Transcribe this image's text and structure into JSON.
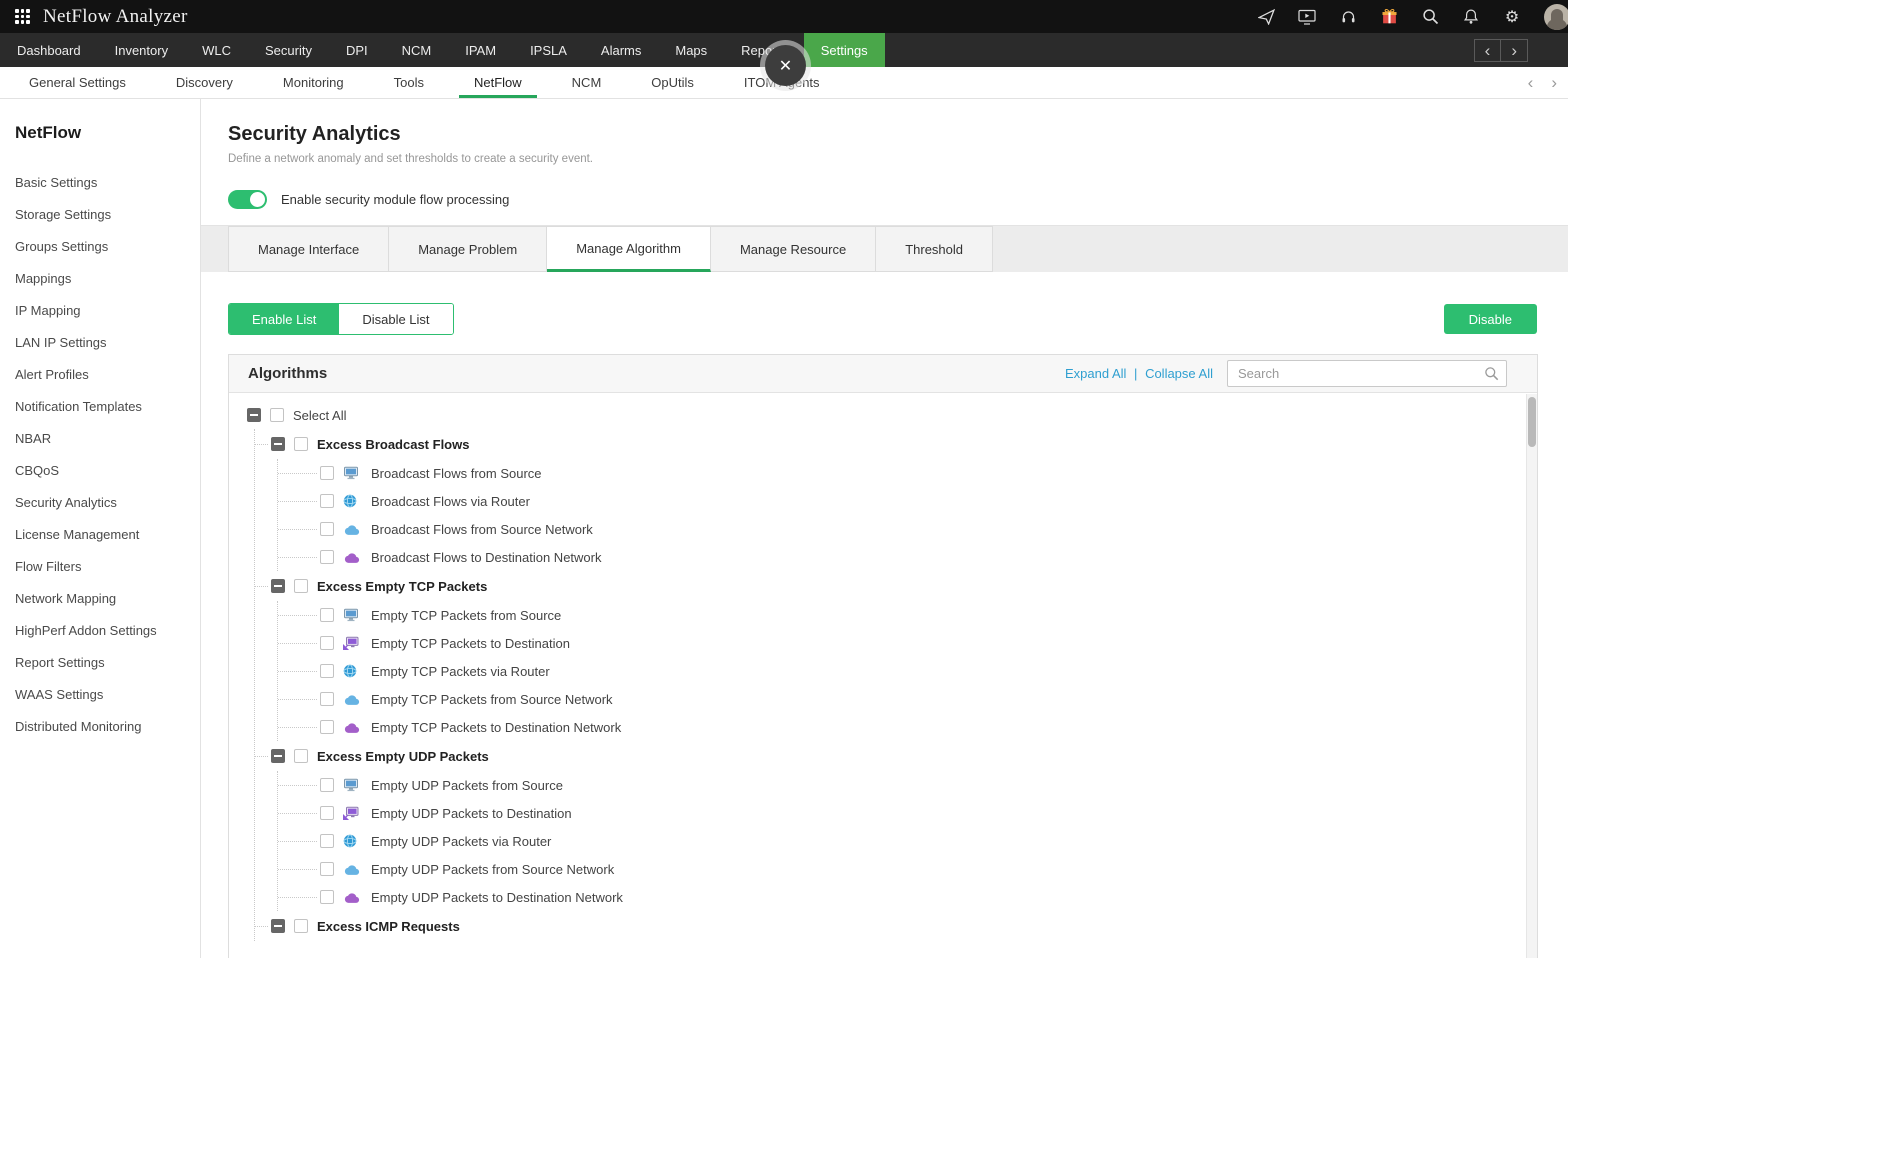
{
  "colors": {
    "accent_green": "#2dbe70",
    "nav_active_green": "#4aa74a",
    "tab_underline_green": "#26a65b",
    "link_blue": "#2f9fd0"
  },
  "icons": {
    "close": "✕",
    "back_chevron": "‹",
    "forward_chevron": "›",
    "gear": "⚙"
  },
  "topbar": {
    "title": "NetFlow Analyzer",
    "icon_names": [
      "send-icon",
      "screen-share-icon",
      "headset-icon",
      "gift-icon",
      "search-icon",
      "bell-icon",
      "gear-icon",
      "user-avatar"
    ]
  },
  "topnav": {
    "items": [
      "Dashboard",
      "Inventory",
      "WLC",
      "Security",
      "DPI",
      "NCM",
      "IPAM",
      "IPSLA",
      "Alarms",
      "Maps",
      "Reports",
      "Settings"
    ],
    "active": "Settings"
  },
  "subnav": {
    "items": [
      "General Settings",
      "Discovery",
      "Monitoring",
      "Tools",
      "NetFlow",
      "NCM",
      "OpUtils",
      "ITOM Agents"
    ],
    "active": "NetFlow"
  },
  "sidebar": {
    "title": "NetFlow",
    "items": [
      "Basic Settings",
      "Storage Settings",
      "Groups Settings",
      "Mappings",
      "IP Mapping",
      "LAN IP Settings",
      "Alert Profiles",
      "Notification Templates",
      "NBAR",
      "CBQoS",
      "Security Analytics",
      "License Management",
      "Flow Filters",
      "Network Mapping",
      "HighPerf Addon Settings",
      "Report Settings",
      "WAAS Settings",
      "Distributed Monitoring"
    ]
  },
  "page": {
    "title": "Security Analytics",
    "subtitle": "Define a network anomaly and set thresholds to create a security event.",
    "toggle_label": "Enable security module flow processing",
    "toggle_state": "on"
  },
  "tabs": {
    "items": [
      "Manage Interface",
      "Manage Problem",
      "Manage Algorithm",
      "Manage Resource",
      "Threshold"
    ],
    "active": "Manage Algorithm"
  },
  "list_toggle": {
    "enable": "Enable List",
    "disable": "Disable List",
    "active": "Enable List"
  },
  "actions": {
    "disable_button": "Disable"
  },
  "algorithms": {
    "title": "Algorithms",
    "expand_all": "Expand All",
    "links_separator": "|",
    "collapse_all": "Collapse All",
    "search_placeholder": "Search",
    "select_all": "Select All",
    "groups": [
      {
        "label": "Excess Broadcast Flows",
        "children": [
          {
            "label": "Broadcast Flows from Source",
            "icon": "host-source-icon"
          },
          {
            "label": "Broadcast Flows via Router",
            "icon": "router-globe-icon"
          },
          {
            "label": "Broadcast Flows from Source Network",
            "icon": "source-network-cloud-icon"
          },
          {
            "label": "Broadcast Flows to Destination Network",
            "icon": "destination-network-cloud-icon"
          }
        ]
      },
      {
        "label": "Excess Empty TCP Packets",
        "children": [
          {
            "label": "Empty TCP Packets from Source",
            "icon": "host-source-icon"
          },
          {
            "label": "Empty TCP Packets to Destination",
            "icon": "host-destination-icon"
          },
          {
            "label": "Empty TCP Packets via Router",
            "icon": "router-globe-icon"
          },
          {
            "label": "Empty TCP Packets from Source Network",
            "icon": "source-network-cloud-icon"
          },
          {
            "label": "Empty TCP Packets to Destination Network",
            "icon": "destination-network-cloud-icon"
          }
        ]
      },
      {
        "label": "Excess Empty UDP Packets",
        "children": [
          {
            "label": "Empty UDP Packets from Source",
            "icon": "host-source-icon"
          },
          {
            "label": "Empty UDP Packets to Destination",
            "icon": "host-destination-icon"
          },
          {
            "label": "Empty UDP Packets via Router",
            "icon": "router-globe-icon"
          },
          {
            "label": "Empty UDP Packets from Source Network",
            "icon": "source-network-cloud-icon"
          },
          {
            "label": "Empty UDP Packets to Destination Network",
            "icon": "destination-network-cloud-icon"
          }
        ]
      },
      {
        "label": "Excess ICMP Requests",
        "children": []
      }
    ]
  }
}
